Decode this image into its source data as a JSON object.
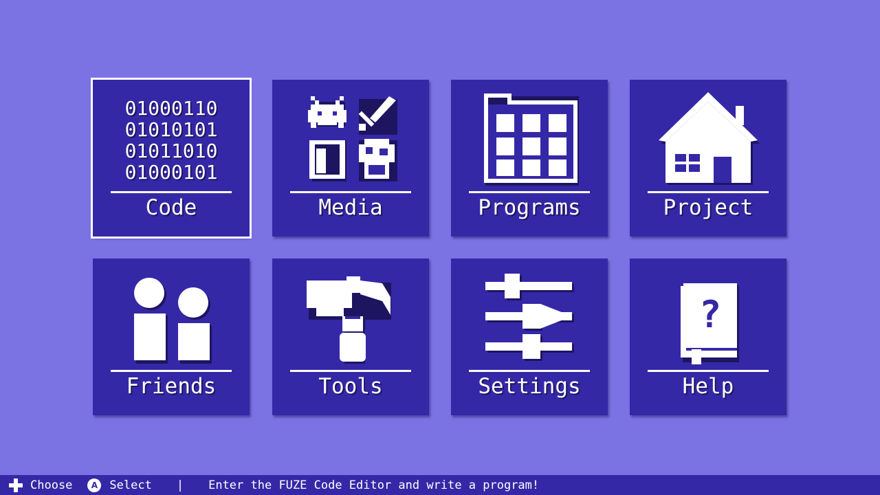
{
  "tiles": [
    {
      "label": "Code",
      "selected": true,
      "icon": "binary-icon",
      "binary": [
        "01000110",
        "01010101",
        "01011010",
        "01000101"
      ]
    },
    {
      "label": "Media",
      "icon": "media-icon"
    },
    {
      "label": "Programs",
      "icon": "folder-grid-icon"
    },
    {
      "label": "Project",
      "icon": "house-icon"
    },
    {
      "label": "Friends",
      "icon": "friends-icon"
    },
    {
      "label": "Tools",
      "icon": "hammer-icon"
    },
    {
      "label": "Settings",
      "icon": "sliders-icon"
    },
    {
      "label": "Help",
      "icon": "help-book-icon"
    }
  ],
  "bottom_bar": {
    "choose_label": "Choose",
    "select_label": "Select",
    "a_button": "A",
    "separator": "|",
    "hint": "Enter the FUZE Code Editor and write a program!"
  },
  "colors": {
    "background": "#7b73e4",
    "tile": "#3528a6",
    "foreground": "#ffffff"
  }
}
